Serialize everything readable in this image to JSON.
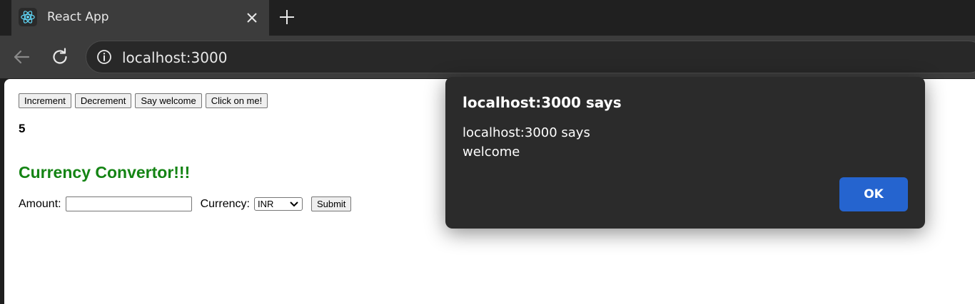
{
  "browser": {
    "tab": {
      "title": "React App",
      "favicon": "react-logo-icon"
    },
    "newtab_icon": "plus-icon",
    "address_bar": {
      "url": "localhost:3000",
      "icon": "info-icon"
    }
  },
  "page": {
    "buttons": [
      "Increment",
      "Decrement",
      "Say welcome",
      "Click on me!"
    ],
    "count": "5",
    "converter": {
      "title": "Currency Convertor!!!",
      "amount_label": "Amount:",
      "amount_value": "",
      "currency_label": "Currency:",
      "currency_selected": "INR",
      "submit_label": "Submit"
    }
  },
  "dialog": {
    "title": "localhost:3000 says",
    "message_line1": "localhost:3000 says",
    "message_line2": "welcome",
    "ok_label": "OK"
  },
  "colors": {
    "converter_title": "#148414",
    "ok_button": "#2564cf",
    "dialog_bg": "#2b2b2b"
  }
}
